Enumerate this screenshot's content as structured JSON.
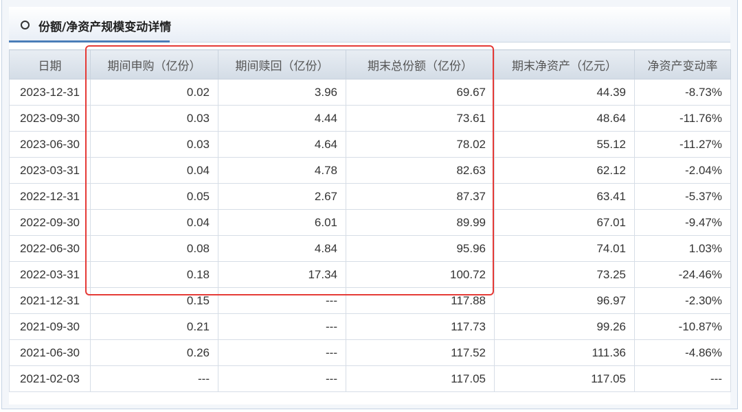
{
  "panel": {
    "title": "份额/净资产规模变动详情"
  },
  "table": {
    "headers": [
      "日期",
      "期间申购（亿份）",
      "期间赎回（亿份）",
      "期末总份额（亿份）",
      "期末净资产（亿元）",
      "净资产变动率"
    ],
    "rows": [
      [
        "2023-12-31",
        "0.02",
        "3.96",
        "69.67",
        "44.39",
        "-8.73%"
      ],
      [
        "2023-09-30",
        "0.03",
        "4.44",
        "73.61",
        "48.64",
        "-11.76%"
      ],
      [
        "2023-06-30",
        "0.03",
        "4.64",
        "78.02",
        "55.12",
        "-11.27%"
      ],
      [
        "2023-03-31",
        "0.04",
        "4.78",
        "82.63",
        "62.12",
        "-2.04%"
      ],
      [
        "2022-12-31",
        "0.05",
        "2.67",
        "87.37",
        "63.41",
        "-5.37%"
      ],
      [
        "2022-09-30",
        "0.04",
        "6.01",
        "89.99",
        "67.01",
        "-9.47%"
      ],
      [
        "2022-06-30",
        "0.08",
        "4.84",
        "95.96",
        "74.01",
        "1.03%"
      ],
      [
        "2022-03-31",
        "0.18",
        "17.34",
        "100.72",
        "73.25",
        "-24.46%"
      ],
      [
        "2021-12-31",
        "0.15",
        "---",
        "117.88",
        "96.97",
        "-2.30%"
      ],
      [
        "2021-09-30",
        "0.21",
        "---",
        "117.73",
        "99.26",
        "-10.87%"
      ],
      [
        "2021-06-30",
        "0.26",
        "---",
        "117.52",
        "111.36",
        "-4.86%"
      ],
      [
        "2021-02-03",
        "---",
        "---",
        "117.05",
        "117.05",
        "---"
      ]
    ]
  },
  "colors": {
    "accent": "#4a7db8",
    "highlight": "#e53935",
    "header_bg": "#d3dce6"
  }
}
